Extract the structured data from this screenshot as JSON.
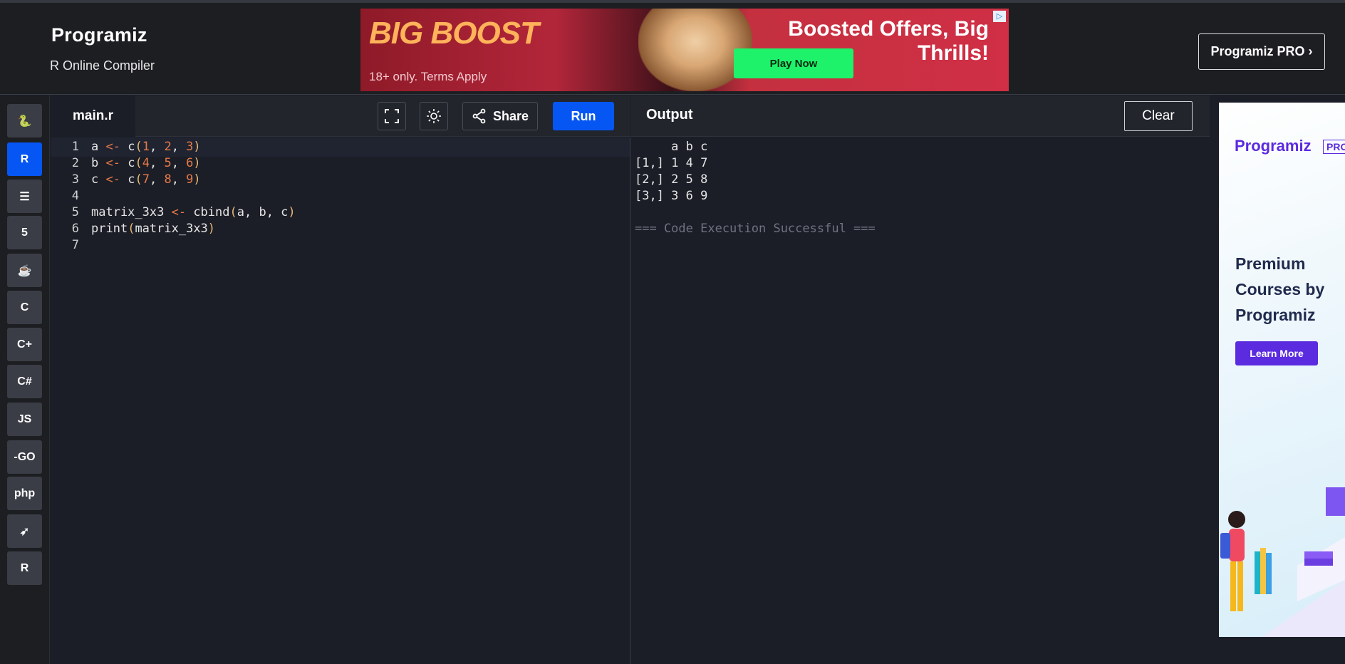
{
  "header": {
    "logo_text": "Programiz",
    "subtitle": "R Online Compiler",
    "pro_button": "Programiz PRO ›"
  },
  "ad_banner": {
    "brand": "BIG BOOST",
    "terms": "18+ only. Terms Apply",
    "offer_line1": "Boosted Offers, Big",
    "offer_line2": "Thrills!",
    "cta": "Play Now",
    "adchoices": "▷"
  },
  "sidebar": {
    "languages": [
      {
        "name": "python",
        "icon": "python-icon",
        "glyph": "🐍",
        "active": false
      },
      {
        "name": "r",
        "icon": "r-icon",
        "glyph": "R",
        "active": true
      },
      {
        "name": "sql",
        "icon": "database-icon",
        "glyph": "☰",
        "active": false
      },
      {
        "name": "html",
        "icon": "html5-icon",
        "glyph": "5",
        "active": false
      },
      {
        "name": "java",
        "icon": "java-icon",
        "glyph": "☕",
        "active": false
      },
      {
        "name": "c",
        "icon": "c-icon",
        "glyph": "C",
        "active": false
      },
      {
        "name": "cpp",
        "icon": "cpp-icon",
        "glyph": "C+",
        "active": false
      },
      {
        "name": "csharp",
        "icon": "csharp-icon",
        "glyph": "C#",
        "active": false
      },
      {
        "name": "javascript",
        "icon": "js-icon",
        "glyph": "JS",
        "active": false
      },
      {
        "name": "go",
        "icon": "go-icon",
        "glyph": "-GO",
        "active": false
      },
      {
        "name": "php",
        "icon": "php-icon",
        "glyph": "php",
        "active": false
      },
      {
        "name": "swift",
        "icon": "swift-icon",
        "glyph": "➶",
        "active": false
      },
      {
        "name": "rust",
        "icon": "rust-icon",
        "glyph": "R",
        "active": false
      }
    ]
  },
  "editor": {
    "filename": "main.r",
    "share_label": "Share",
    "run_label": "Run",
    "lines": [
      {
        "n": "1",
        "text": "a <- c(1, 2, 3)"
      },
      {
        "n": "2",
        "text": "b <- c(4, 5, 6)"
      },
      {
        "n": "3",
        "text": "c <- c(7, 8, 9)"
      },
      {
        "n": "4",
        "text": ""
      },
      {
        "n": "5",
        "text": "matrix_3x3 <- cbind(a, b, c)"
      },
      {
        "n": "6",
        "text": "print(matrix_3x3)"
      },
      {
        "n": "7",
        "text": ""
      }
    ]
  },
  "output": {
    "title": "Output",
    "clear_label": "Clear",
    "lines": [
      "     a b c",
      "[1,] 1 4 7",
      "[2,] 2 5 8",
      "[3,] 3 6 9",
      "",
      "=== Code Execution Successful ==="
    ]
  },
  "side_ad": {
    "logo": "Programiz",
    "pro_tag": "PRO",
    "headline": "Premium Courses by Programiz",
    "cta": "Learn More"
  }
}
